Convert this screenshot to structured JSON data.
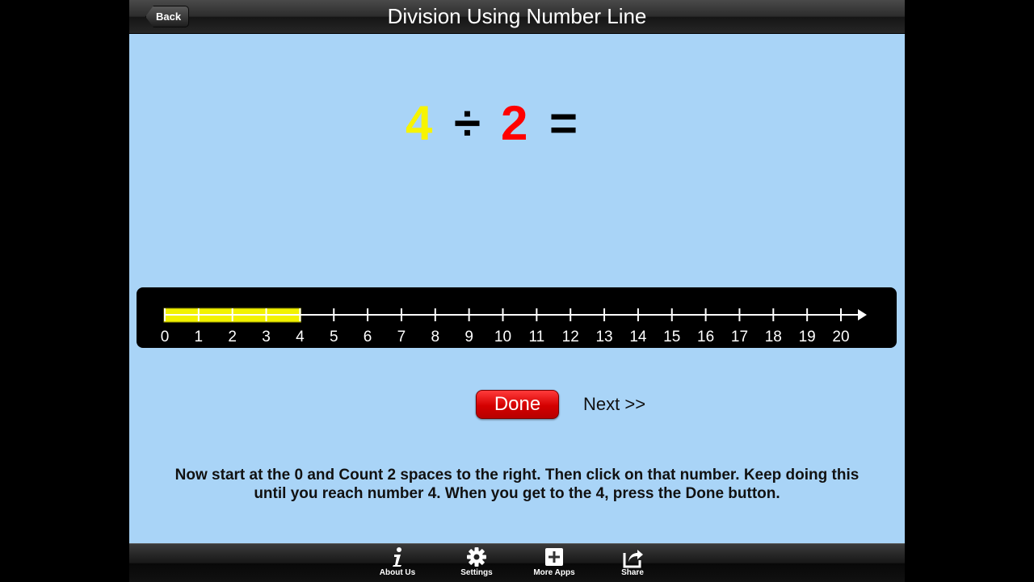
{
  "header": {
    "back_label": "Back",
    "title": "Division Using Number Line"
  },
  "equation": {
    "dividend": "4",
    "operator": "÷",
    "divisor": "2",
    "equals": "="
  },
  "number_line": {
    "min": 0,
    "max": 20,
    "labels": [
      "0",
      "1",
      "2",
      "3",
      "4",
      "5",
      "6",
      "7",
      "8",
      "9",
      "10",
      "11",
      "12",
      "13",
      "14",
      "15",
      "16",
      "17",
      "18",
      "19",
      "20"
    ],
    "highlight_from": 0,
    "highlight_to": 4,
    "highlight_color": "#f2f200",
    "line_color": "#ffffff"
  },
  "actions": {
    "done_label": "Done",
    "next_label": "Next >>"
  },
  "instructions": {
    "line1": "Now start at the 0 and Count 2 spaces to the right. Then click on that number. Keep doing this",
    "line2": "until you reach number 4. When you get to the 4, press the Done button."
  },
  "tabbar": {
    "items": [
      {
        "label": "About Us",
        "icon": "info-icon"
      },
      {
        "label": "Settings",
        "icon": "gear-icon"
      },
      {
        "label": "More Apps",
        "icon": "plus-icon"
      },
      {
        "label": "Share",
        "icon": "share-icon"
      }
    ]
  },
  "colors": {
    "background": "#a9d4f7",
    "dividend": "#f7f400",
    "divisor": "#ff0000",
    "done_button": "#d40000"
  }
}
